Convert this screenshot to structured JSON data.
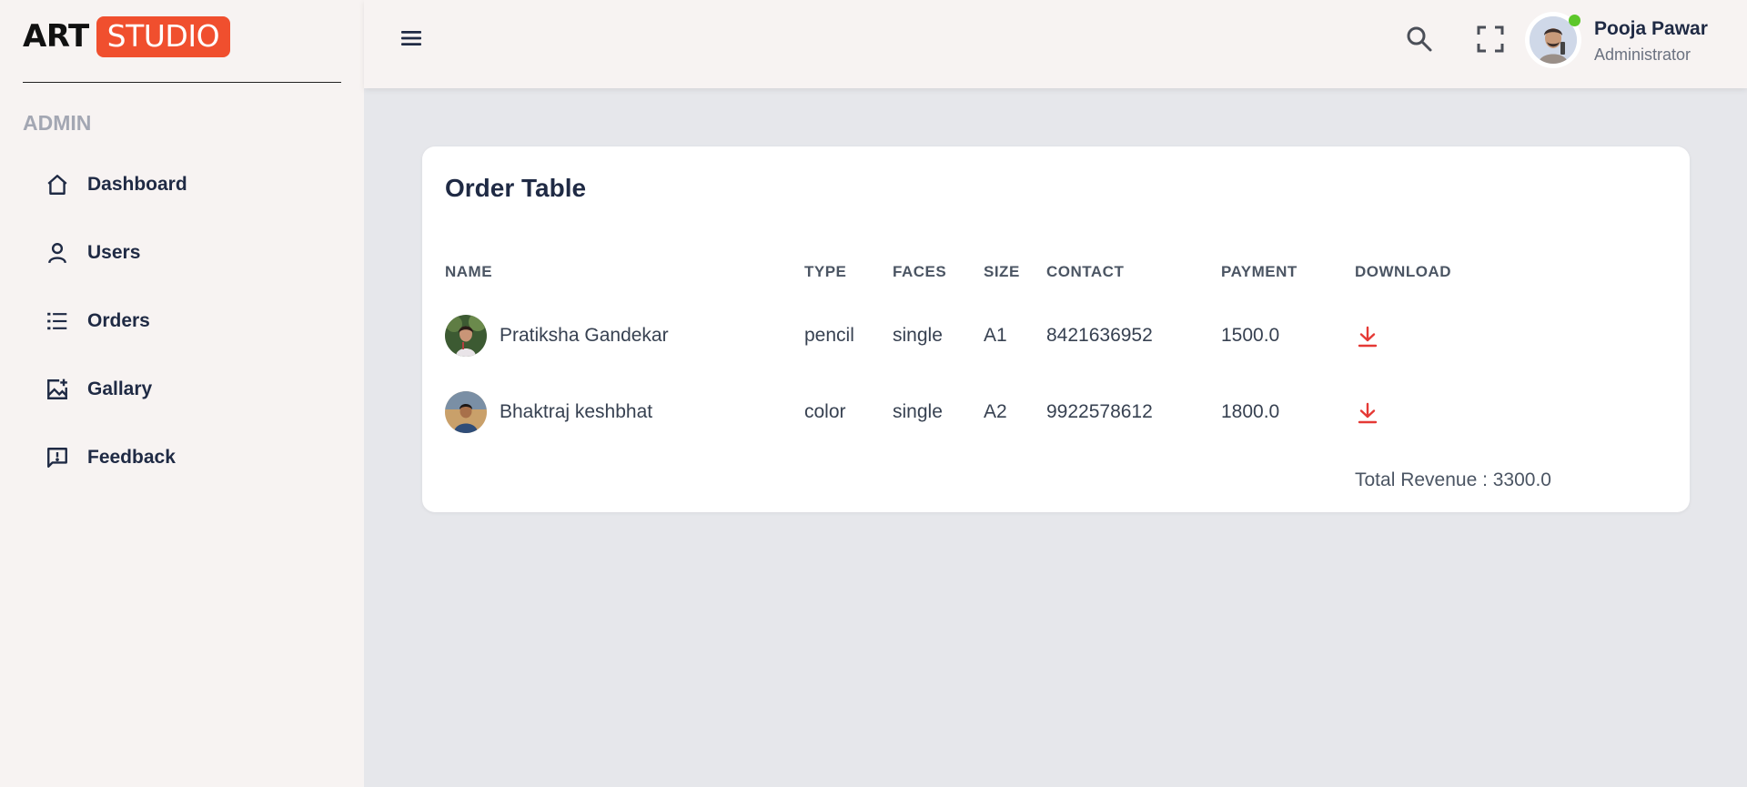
{
  "brand": {
    "part1": "ART",
    "part2": "STUDIO"
  },
  "sidebar": {
    "section": "ADMIN",
    "items": [
      {
        "label": "Dashboard",
        "icon": "home-icon"
      },
      {
        "label": "Users",
        "icon": "user-icon"
      },
      {
        "label": "Orders",
        "icon": "list-icon"
      },
      {
        "label": "Gallary",
        "icon": "gallery-icon"
      },
      {
        "label": "Feedback",
        "icon": "feedback-icon"
      }
    ]
  },
  "topbar": {
    "user_name": "Pooja Pawar",
    "user_role": "Administrator"
  },
  "table": {
    "title": "Order Table",
    "headers": {
      "name": "NAME",
      "type": "TYPE",
      "faces": "FACES",
      "size": "SIZE",
      "contact": "CONTACT",
      "payment": "PAYMENT",
      "download": "DOWNLOAD"
    },
    "rows": [
      {
        "name": "Pratiksha Gandekar",
        "type": "pencil",
        "faces": "single",
        "size": "A1",
        "contact": "8421636952",
        "payment": "1500.0"
      },
      {
        "name": "Bhaktraj keshbhat",
        "type": "color",
        "faces": "single",
        "size": "A2",
        "contact": "9922578612",
        "payment": "1800.0"
      }
    ],
    "total_label": "Total Revenue : 3300.0"
  },
  "colors": {
    "brand": "#f04f2e",
    "download": "#e53935",
    "online": "#5cc72a"
  }
}
